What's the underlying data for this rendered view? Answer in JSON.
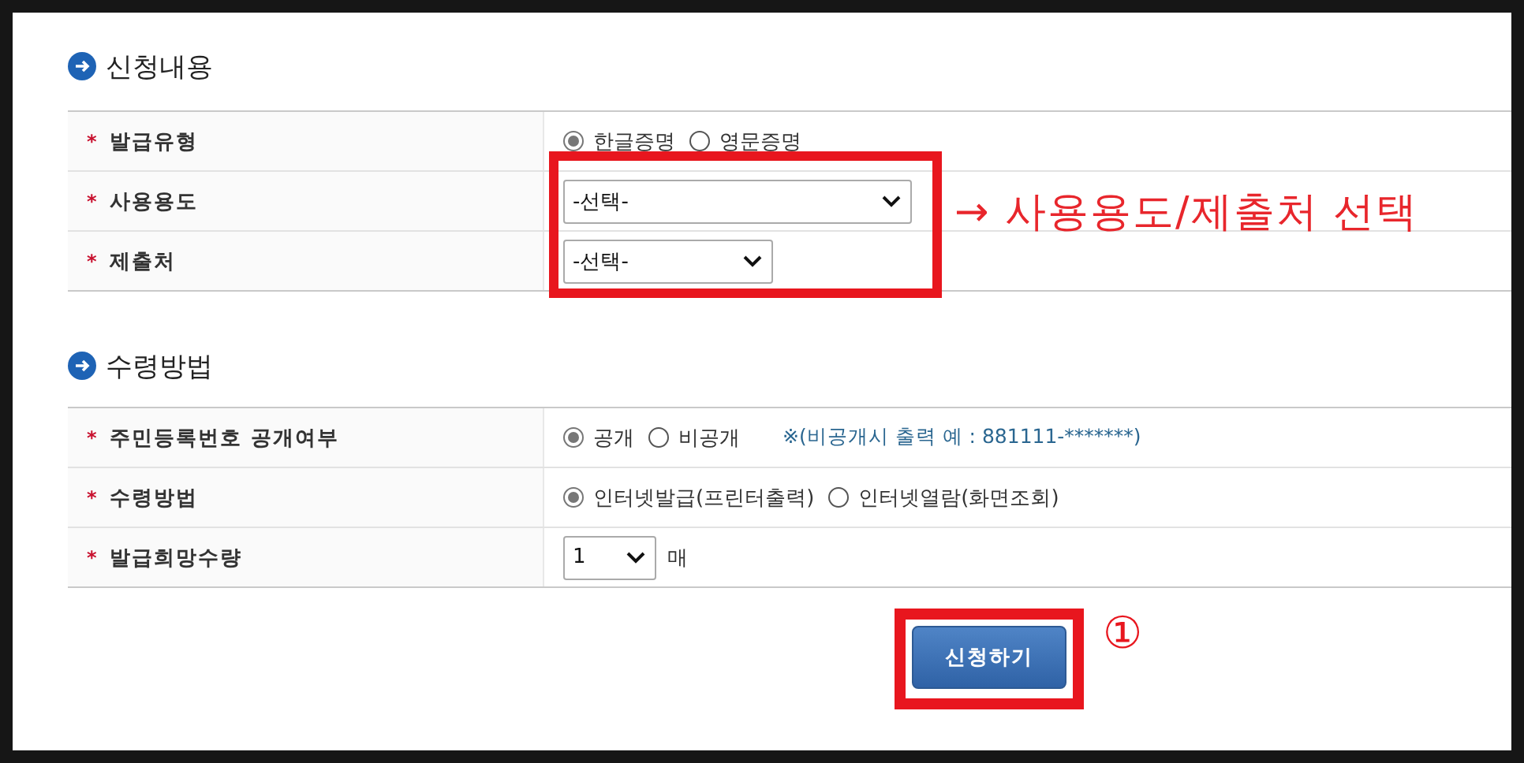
{
  "sections": [
    {
      "title": "신청내용",
      "rows": [
        {
          "marker": "*",
          "label": "발급유형",
          "kind": "radio",
          "options": [
            {
              "label": "한글증명",
              "selected": true
            },
            {
              "label": "영문증명",
              "selected": false
            }
          ]
        },
        {
          "marker": "*",
          "label": "사용용도",
          "kind": "select",
          "value": "-선택-"
        },
        {
          "marker": "*",
          "label": "제출처",
          "kind": "select",
          "value": "-선택-"
        }
      ]
    },
    {
      "title": "수령방법",
      "rows": [
        {
          "marker": "*",
          "label": "주민등록번호 공개여부",
          "kind": "radio",
          "options": [
            {
              "label": "공개",
              "selected": true
            },
            {
              "label": "비공개",
              "selected": false
            }
          ],
          "note": "※(비공개시 출력 예 : 881111-*******)"
        },
        {
          "marker": "*",
          "label": "수령방법",
          "kind": "radio",
          "options": [
            {
              "label": "인터넷발급(프린터출력)",
              "selected": true
            },
            {
              "label": "인터넷열람(화면조회)",
              "selected": false
            }
          ]
        },
        {
          "marker": "*",
          "label": "발급희망수량",
          "kind": "select",
          "value": "1",
          "unit": "매"
        }
      ]
    }
  ],
  "submit_button": "신청하기",
  "callout": "→ 사용용도/제출처 선택",
  "step": "①"
}
